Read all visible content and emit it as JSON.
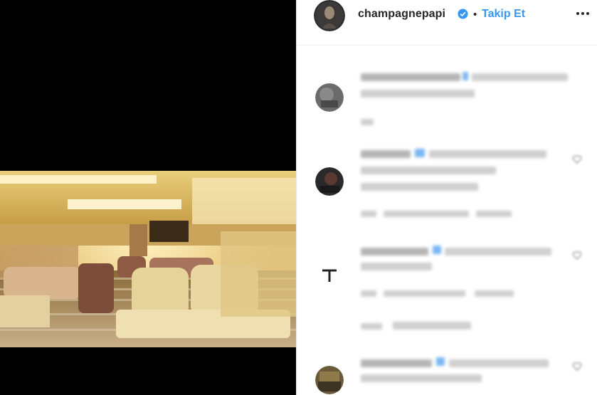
{
  "header": {
    "username": "champagnepapi",
    "separator": "•",
    "follow_label": "Takip Et",
    "more_icon": "more-icon"
  },
  "media": {
    "icon": "jet-interior-photo"
  },
  "comments": [
    {
      "avatar": "avatar-gray"
    },
    {
      "avatar": "avatar-dark"
    },
    {
      "avatar": "avatar-anchor"
    },
    {
      "avatar": "avatar-gold"
    }
  ],
  "colors": {
    "accent": "#3897f0",
    "text": "#262626",
    "border": "#efefef"
  }
}
